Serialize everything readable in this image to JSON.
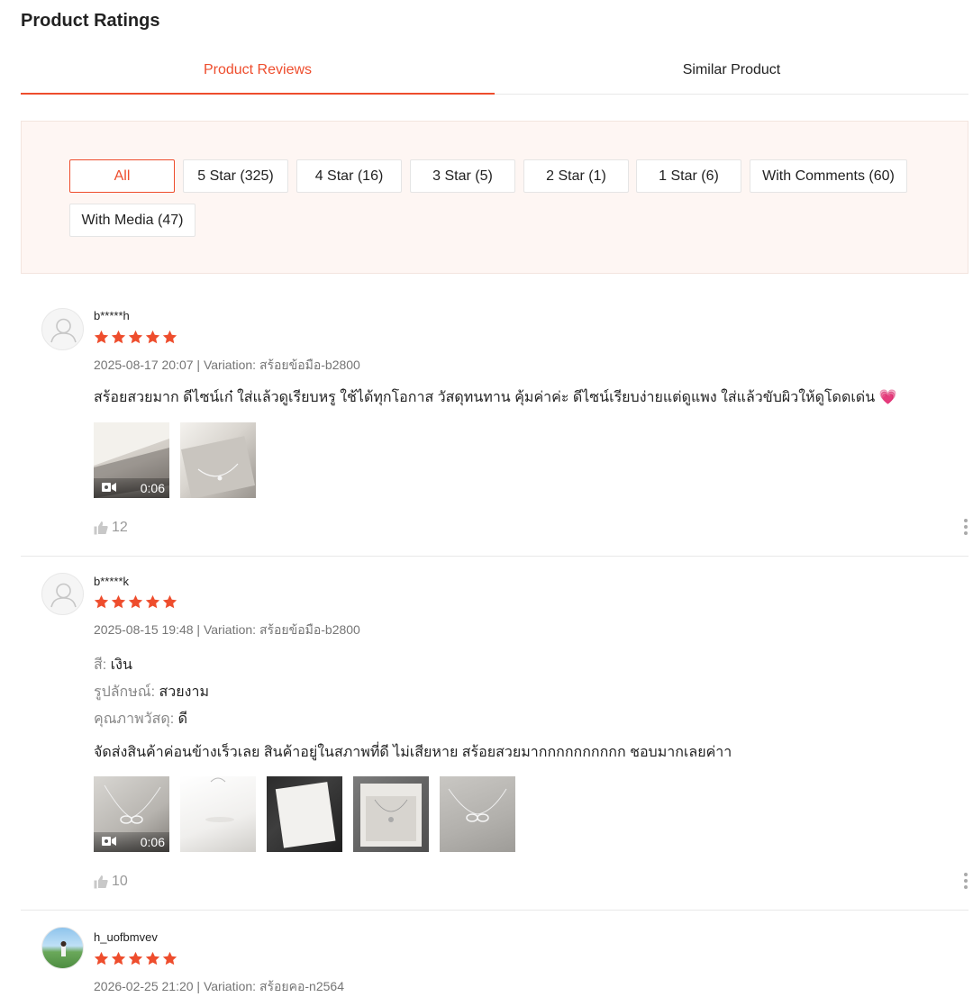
{
  "title": "Product Ratings",
  "tabs": [
    {
      "label": "Product Reviews",
      "active": true
    },
    {
      "label": "Similar Product",
      "active": false
    }
  ],
  "filters": [
    {
      "label": "All",
      "active": true
    },
    {
      "label": "5 Star (325)"
    },
    {
      "label": "4 Star (16)"
    },
    {
      "label": "3 Star (5)"
    },
    {
      "label": "2 Star (1)"
    },
    {
      "label": "1 Star (6)"
    },
    {
      "label": "With Comments (60)"
    },
    {
      "label": "With Media (47)"
    }
  ],
  "colors": {
    "accent": "#ee4d2d",
    "panel_bg": "#fef6f3",
    "muted": "#757575"
  },
  "reviews": [
    {
      "username": "b*****h",
      "rating": 5,
      "meta": "2025-08-17 20:07 | Variation: สร้อยข้อมือ-b2800",
      "comment": "สร้อยสวยมาก ดีไซน์เก๋ ใส่แล้วดูเรียบหรู ใช้ได้ทุกโอกาส วัสดุทนทาน คุ้มค่าค่ะ  ดีไซน์เรียบง่ายแต่ดูแพง ใส่แล้วขับผิวให้ดูโดดเด่น 💗",
      "video_duration": "0:06",
      "likes": "12"
    },
    {
      "username": "b*****k",
      "rating": 5,
      "meta": "2025-08-15 19:48 | Variation: สร้อยข้อมือ-b2800",
      "attributes": [
        {
          "key": "สี:",
          "value": "เงิน"
        },
        {
          "key": "รูปลักษณ์:",
          "value": "สวยงาม"
        },
        {
          "key": "คุณภาพวัสดุ:",
          "value": "ดี"
        }
      ],
      "comment": "จัดส่งสินค้าค่อนข้างเร็วเลย สินค้าอยู่ในสภาพที่ดี ไม่เสียหาย สร้อยสวยมากกกกกกกกกก ชอบมากเลยค่าา",
      "video_duration": "0:06",
      "likes": "10"
    },
    {
      "username": "h_uofbmvev",
      "rating": 5,
      "meta": "2026-02-25 21:20 | Variation: สร้อยคอ-n2564"
    }
  ]
}
